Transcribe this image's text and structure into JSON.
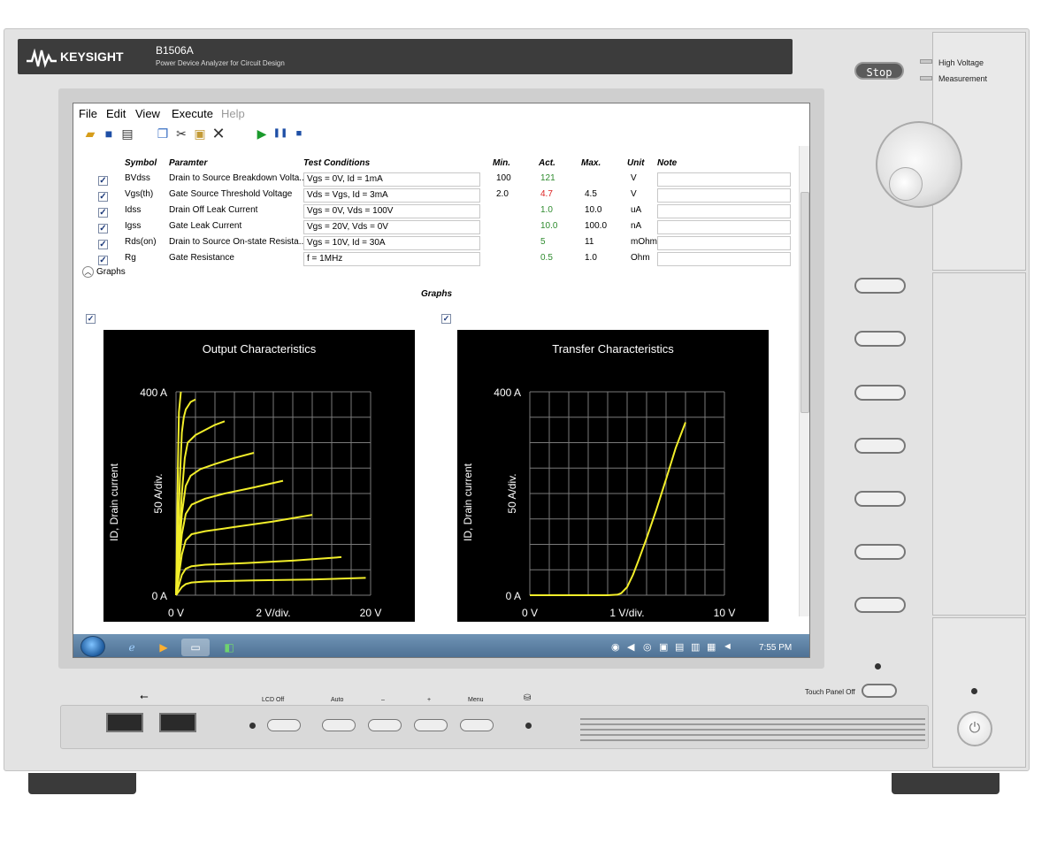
{
  "header": {
    "brand": "KEYSIGHT",
    "model": "B1506A",
    "subtitle": "Power Device Analyzer for Circuit Design"
  },
  "menu": [
    "File",
    "Edit",
    "View",
    "Execute",
    "Help"
  ],
  "table": {
    "headers": {
      "symbol": "Symbol",
      "parameter": "Paramter",
      "test_conditions": "Test Conditions",
      "min": "Min.",
      "act": "Act.",
      "max": "Max.",
      "unit": "Unit",
      "note": "Note"
    },
    "rows": [
      {
        "checked": "✓",
        "symbol": "BVdss",
        "parameter": "Drain to Source Breakdown Volta...",
        "test": "Vgs = 0V, Id = 1mA",
        "min": "100",
        "act": "121",
        "act_color": "#2e8b2e",
        "max": "",
        "unit": "V"
      },
      {
        "checked": "✓",
        "symbol": "Vgs(th)",
        "parameter": "Gate Source Threshold Voltage",
        "test": "Vds = Vgs, Id = 3mA",
        "min": "2.0",
        "act": "4.7",
        "act_color": "#d22",
        "max": "4.5",
        "unit": "V"
      },
      {
        "checked": "✓",
        "symbol": "Idss",
        "parameter": "Drain Off Leak Current",
        "test": "Vgs = 0V, Vds = 100V",
        "min": "",
        "act": "1.0",
        "act_color": "#2e8b2e",
        "max": "10.0",
        "unit": "uA"
      },
      {
        "checked": "✓",
        "symbol": "Igss",
        "parameter": "Gate Leak Current",
        "test": "Vgs = 20V, Vds = 0V",
        "min": "",
        "act": "10.0",
        "act_color": "#2e8b2e",
        "max": "100.0",
        "unit": "nA"
      },
      {
        "checked": "✓",
        "symbol": "Rds(on)",
        "parameter": "Drain to Source On-state Resista...",
        "test": "Vgs = 10V, Id = 30A",
        "min": "",
        "act": "5",
        "act_color": "#2e8b2e",
        "max": "11",
        "unit": "mOhm"
      },
      {
        "checked": "✓",
        "symbol": "Rg",
        "parameter": "Gate Resistance",
        "test": "f = 1MHz",
        "min": "",
        "act": "0.5",
        "act_color": "#2e8b2e",
        "max": "1.0",
        "unit": "Ohm"
      }
    ]
  },
  "graphs": {
    "toggle_label": "Graphs",
    "section_title": "Graphs",
    "checkbox": "✓"
  },
  "chart_data": [
    {
      "type": "line",
      "title": "Output Characteristics",
      "xlabel": "2 V/div.",
      "ylabel": "ID, Drain current",
      "ylabel2": "50 A/div.",
      "x_tick_labels": [
        "0 V",
        "20 V"
      ],
      "y_tick_labels": [
        "0 A",
        "400 A"
      ],
      "xlim": [
        0,
        20
      ],
      "ylim": [
        0,
        400
      ],
      "grid": true,
      "line_color": "#f2ee2a",
      "series": [
        {
          "x": [
            0,
            0.1,
            0.2,
            0.3,
            0.5
          ],
          "y": [
            0,
            120,
            260,
            360,
            400
          ]
        },
        {
          "x": [
            0,
            0.2,
            0.4,
            0.6,
            0.8,
            1.0,
            1.5,
            2.0
          ],
          "y": [
            0,
            110,
            230,
            320,
            350,
            365,
            380,
            385
          ]
        },
        {
          "x": [
            0,
            0.3,
            0.6,
            0.9,
            1.2,
            2,
            3,
            4,
            5
          ],
          "y": [
            0,
            100,
            200,
            270,
            300,
            315,
            325,
            335,
            342
          ]
        },
        {
          "x": [
            0,
            0.3,
            0.6,
            1.0,
            1.5,
            2.5,
            4,
            6,
            8
          ],
          "y": [
            0,
            80,
            160,
            215,
            235,
            248,
            258,
            270,
            280
          ]
        },
        {
          "x": [
            0,
            0.3,
            0.6,
            1.0,
            1.6,
            3,
            5,
            8,
            11
          ],
          "y": [
            0,
            60,
            120,
            160,
            178,
            190,
            200,
            212,
            225
          ]
        },
        {
          "x": [
            0,
            0.3,
            0.6,
            1.0,
            1.6,
            3,
            6,
            10,
            14
          ],
          "y": [
            0,
            40,
            80,
            108,
            120,
            126,
            134,
            145,
            158
          ]
        },
        {
          "x": [
            0,
            0.3,
            0.6,
            1.0,
            1.6,
            3,
            7,
            12,
            17
          ],
          "y": [
            0,
            20,
            40,
            52,
            57,
            60,
            63,
            68,
            75
          ]
        },
        {
          "x": [
            0,
            0.3,
            0.6,
            1.0,
            1.6,
            3,
            8,
            14,
            19.5
          ],
          "y": [
            0,
            8,
            16,
            22,
            25,
            27,
            29,
            31,
            34
          ]
        }
      ]
    },
    {
      "type": "line",
      "title": "Transfer Characteristics",
      "xlabel": "1 V/div.",
      "ylabel": "ID, Drain current",
      "ylabel2": "50 A/div.",
      "x_tick_labels": [
        "0 V",
        "10 V"
      ],
      "y_tick_labels": [
        "0 A",
        "400 A"
      ],
      "xlim": [
        0,
        10
      ],
      "ylim": [
        0,
        400
      ],
      "grid": true,
      "line_color": "#f2ee2a",
      "series": [
        {
          "x": [
            0,
            4,
            4.5,
            4.7,
            5.0,
            5.3,
            5.6,
            6.0,
            6.5,
            7.0,
            7.5,
            8.0
          ],
          "y": [
            0,
            0,
            1,
            4,
            16,
            40,
            70,
            112,
            168,
            228,
            290,
            340
          ]
        }
      ]
    }
  ],
  "taskbar": {
    "clock": "7:55 PM"
  },
  "front_panel": {
    "stop": "Stop",
    "high_voltage": "High Voltage",
    "measurement": "Measurement",
    "lcd_off": "LCD Off",
    "auto": "Auto",
    "minus": "–",
    "plus": "+",
    "menu": "Menu",
    "touch_panel_off": "Touch Panel Off"
  },
  "colors": {
    "chart_bg": "#000000",
    "grid": "#7a7a7a",
    "trace": "#f2ee2a",
    "pass": "#2e8b2e",
    "fail": "#d22"
  }
}
